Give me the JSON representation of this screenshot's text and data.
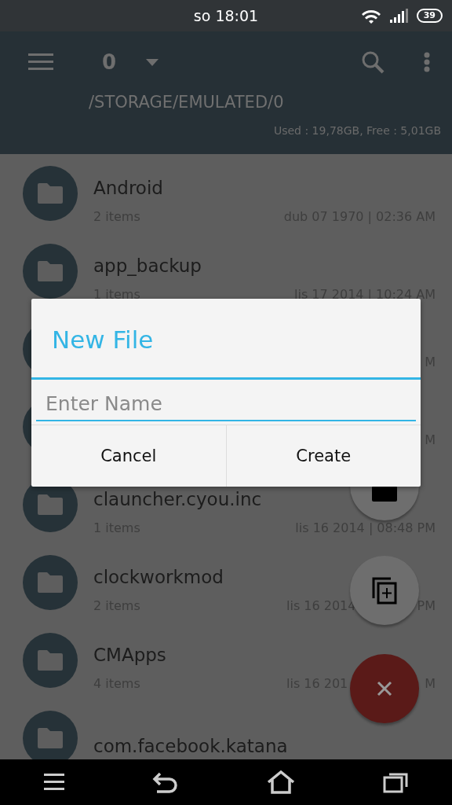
{
  "status_bar": {
    "time": "so 18:01",
    "battery": "39"
  },
  "app_bar": {
    "title": "0",
    "path": "/STORAGE/EMULATED/0",
    "storage": "Used : 19,78GB, Free : 5,01GB"
  },
  "files": [
    {
      "name": "Android",
      "items": "2 items",
      "date": "dub 07 1970 | 02:36 AM"
    },
    {
      "name": "app_backup",
      "items": "1 items",
      "date": "lis 17 2014 | 10:24 AM"
    },
    {
      "date_end": "M"
    },
    {
      "date_end": "M"
    },
    {
      "name": "clauncher.cyou.inc",
      "items": "1 items",
      "date": "lis 16 2014 | 08:48 PM"
    },
    {
      "name": "clockworkmod",
      "items": "2 items",
      "date": "lis 16 2014",
      "date_end": "PM"
    },
    {
      "name": "CMApps",
      "items": "4 items",
      "date": "lis 16 201",
      "date_end": "M"
    },
    {
      "name": "com.facebook.katana"
    }
  ],
  "dialog": {
    "title": "New File",
    "placeholder": "Enter Name",
    "buttons": [
      "Cancel",
      "Create"
    ]
  }
}
